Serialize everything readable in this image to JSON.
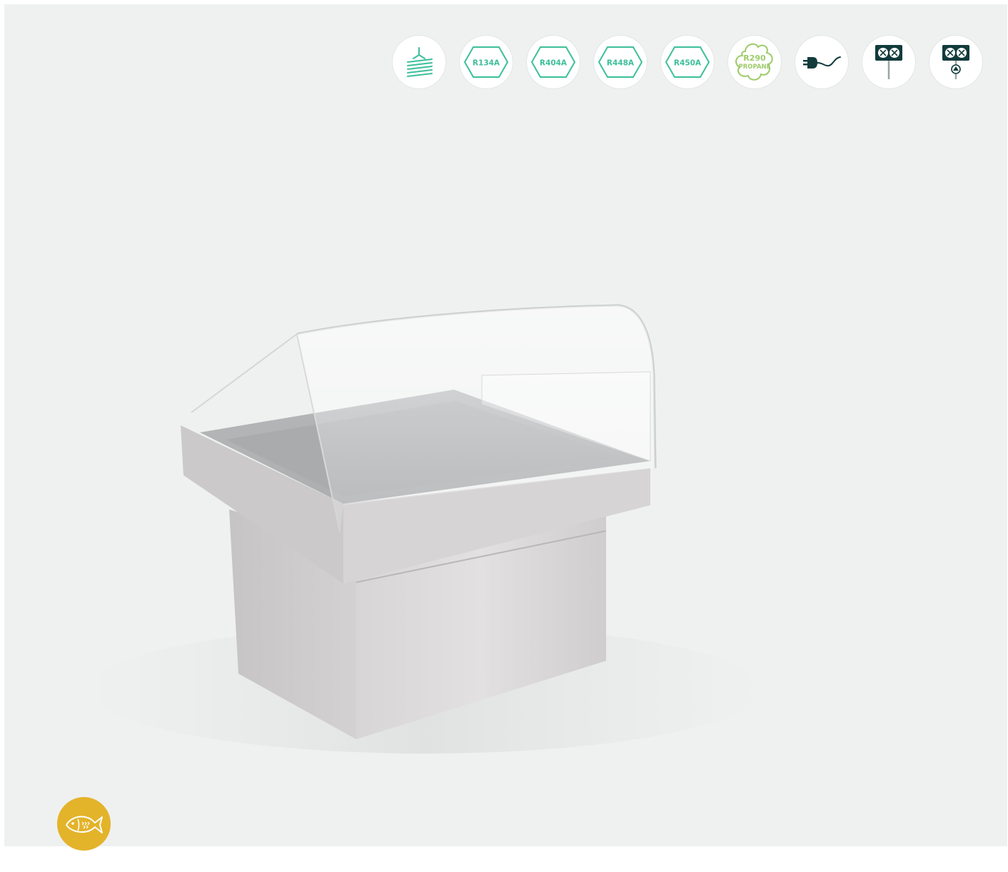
{
  "feature_icons": [
    {
      "name": "fan-cooling-icon",
      "label": ""
    },
    {
      "name": "refrigerant-r134a-icon",
      "label": "R134A"
    },
    {
      "name": "refrigerant-r404a-icon",
      "label": "R404A"
    },
    {
      "name": "refrigerant-r448a-icon",
      "label": "R448A"
    },
    {
      "name": "refrigerant-r450a-icon",
      "label": "R450A"
    },
    {
      "name": "refrigerant-r290-propane-icon",
      "label": "R290",
      "sublabel": "PROPANE"
    },
    {
      "name": "plug-in-icon",
      "label": ""
    },
    {
      "name": "remote-unit-icon",
      "label": ""
    },
    {
      "name": "remote-unit-pump-icon",
      "label": ""
    }
  ],
  "colors": {
    "background": "#eff1f0",
    "teal": "#3dbf9a",
    "green": "#9ecb6b",
    "dark": "#123b3c",
    "category_badge": "#e3b32a"
  },
  "category": {
    "icon": "fish-icon"
  }
}
